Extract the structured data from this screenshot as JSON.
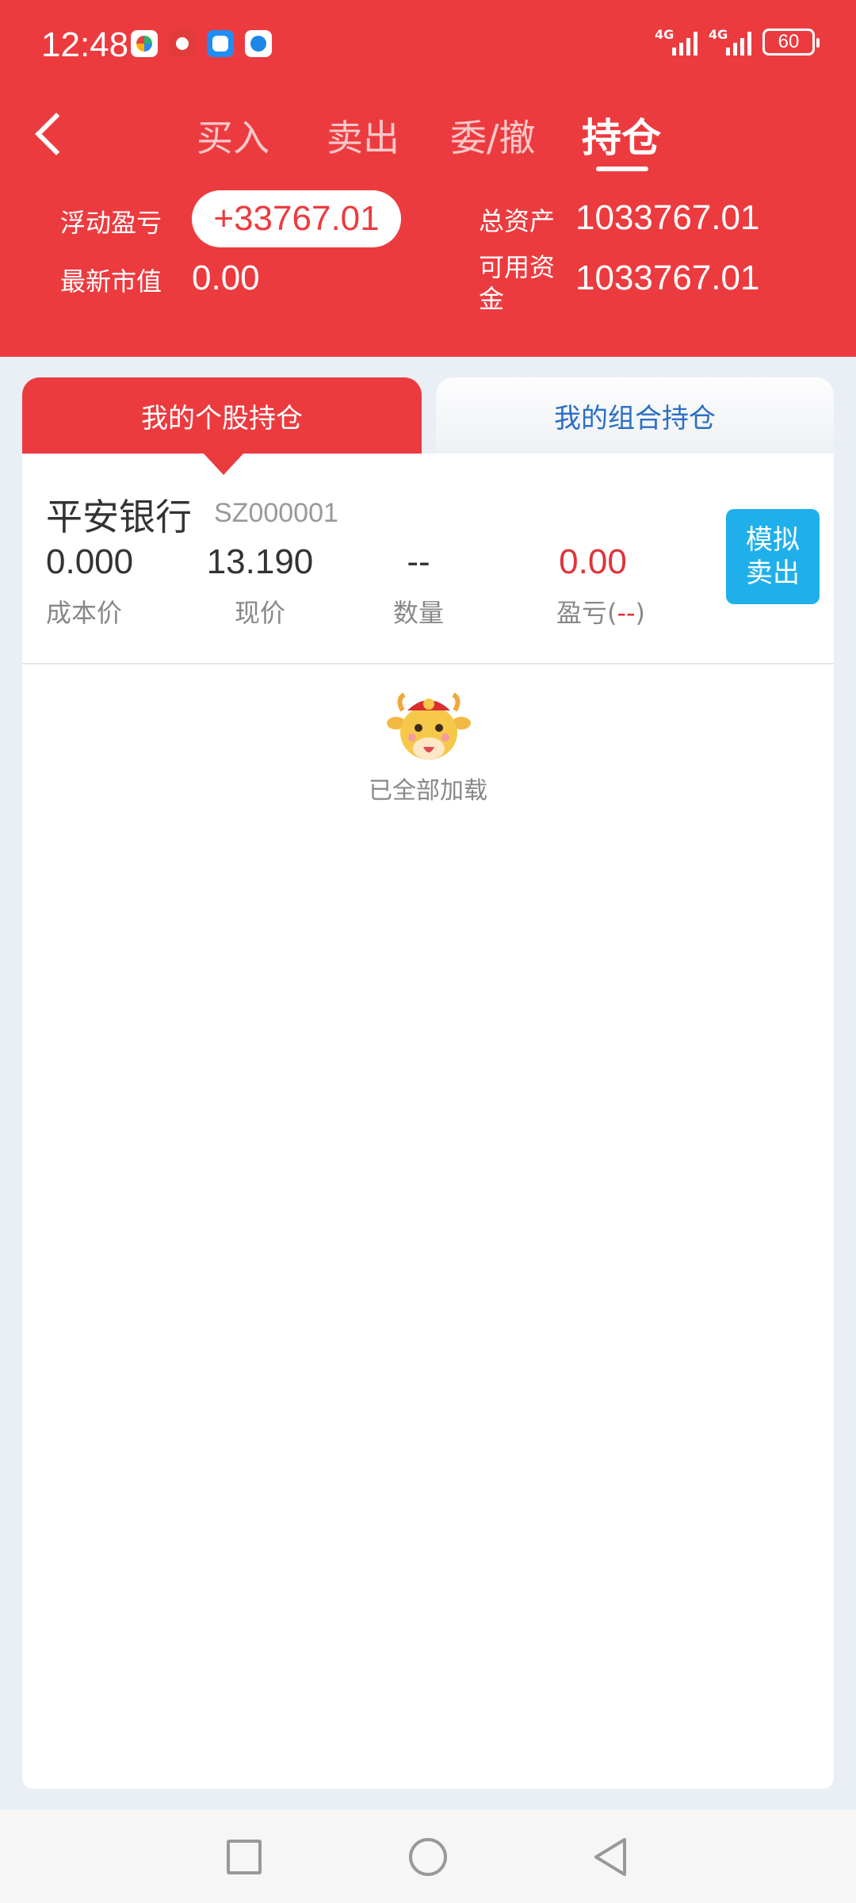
{
  "status_bar": {
    "time": "12:48",
    "network_label": "4G",
    "battery": "60",
    "app_icons": [
      "app-icon-1",
      "app-icon-2",
      "app-icon-3",
      "app-icon-4"
    ]
  },
  "nav": {
    "tabs": [
      {
        "label": "买入"
      },
      {
        "label": "卖出"
      },
      {
        "label": "委/撤"
      },
      {
        "label": "持仓"
      }
    ],
    "active_tab": "持仓"
  },
  "summary": {
    "float_pl_label": "浮动盈亏",
    "float_pl_value": "+33767.01",
    "market_value_label": "最新市值",
    "market_value": "0.00",
    "total_assets_label": "总资产",
    "total_assets": "1033767.01",
    "available_funds_label": "可用资金",
    "available_funds_line1": "可用资",
    "available_funds_line2": "金",
    "available_funds": "1033767.01"
  },
  "segments": {
    "left": "我的个股持仓",
    "right": "我的组合持仓"
  },
  "holding": {
    "name": "平安银行",
    "code": "SZ000001",
    "cost_price": "0.000",
    "cost_price_label": "成本价",
    "current_price": "13.190",
    "current_price_label": "现价",
    "quantity": "--",
    "quantity_label": "数量",
    "pl_value": "0.00",
    "pl_label_prefix": "盈亏(",
    "pl_label_value": "--",
    "pl_label_suffix": ")",
    "sell_button_line1": "模拟",
    "sell_button_line2": "卖出"
  },
  "footer_message": "已全部加载",
  "colors": {
    "brand_red": "#ec3b3f",
    "sell_blue": "#1fb0eb",
    "link_blue": "#2b6fc4"
  }
}
